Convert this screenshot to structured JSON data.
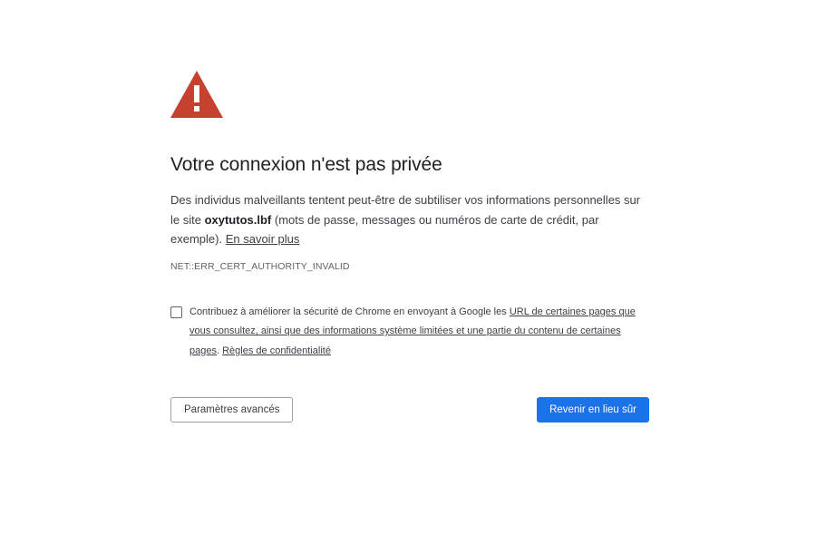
{
  "heading": "Votre connexion n'est pas privée",
  "explanation": {
    "before_site": "Des individus malveillants tentent peut-être de subtiliser vos informations personnelles sur le site ",
    "site": "oxytutos.lbf",
    "after_site": " (mots de passe, messages ou numéros de carte de crédit, par exemple). ",
    "learn_more": "En savoir plus"
  },
  "error_code": "NET::ERR_CERT_AUTHORITY_INVALID",
  "optin": {
    "checked": false,
    "text_before": "Contribuez à améliorer la sécurité de Chrome en envoyant à Google les ",
    "link_urls": "URL de certaines pages que vous consultez, ainsi que des informations système limitées et une partie du contenu de certaines pages",
    "separator": ". ",
    "privacy_link": "Règles de confidentialité"
  },
  "buttons": {
    "advanced": "Paramètres avancés",
    "back_to_safety": "Revenir en lieu sûr"
  },
  "colors": {
    "warning_icon": "#c5422f",
    "primary_button": "#1a73e8",
    "text": "#202124"
  },
  "icons": {
    "warning": "warning-triangle-icon",
    "checkbox": "checkbox-unchecked-icon"
  }
}
